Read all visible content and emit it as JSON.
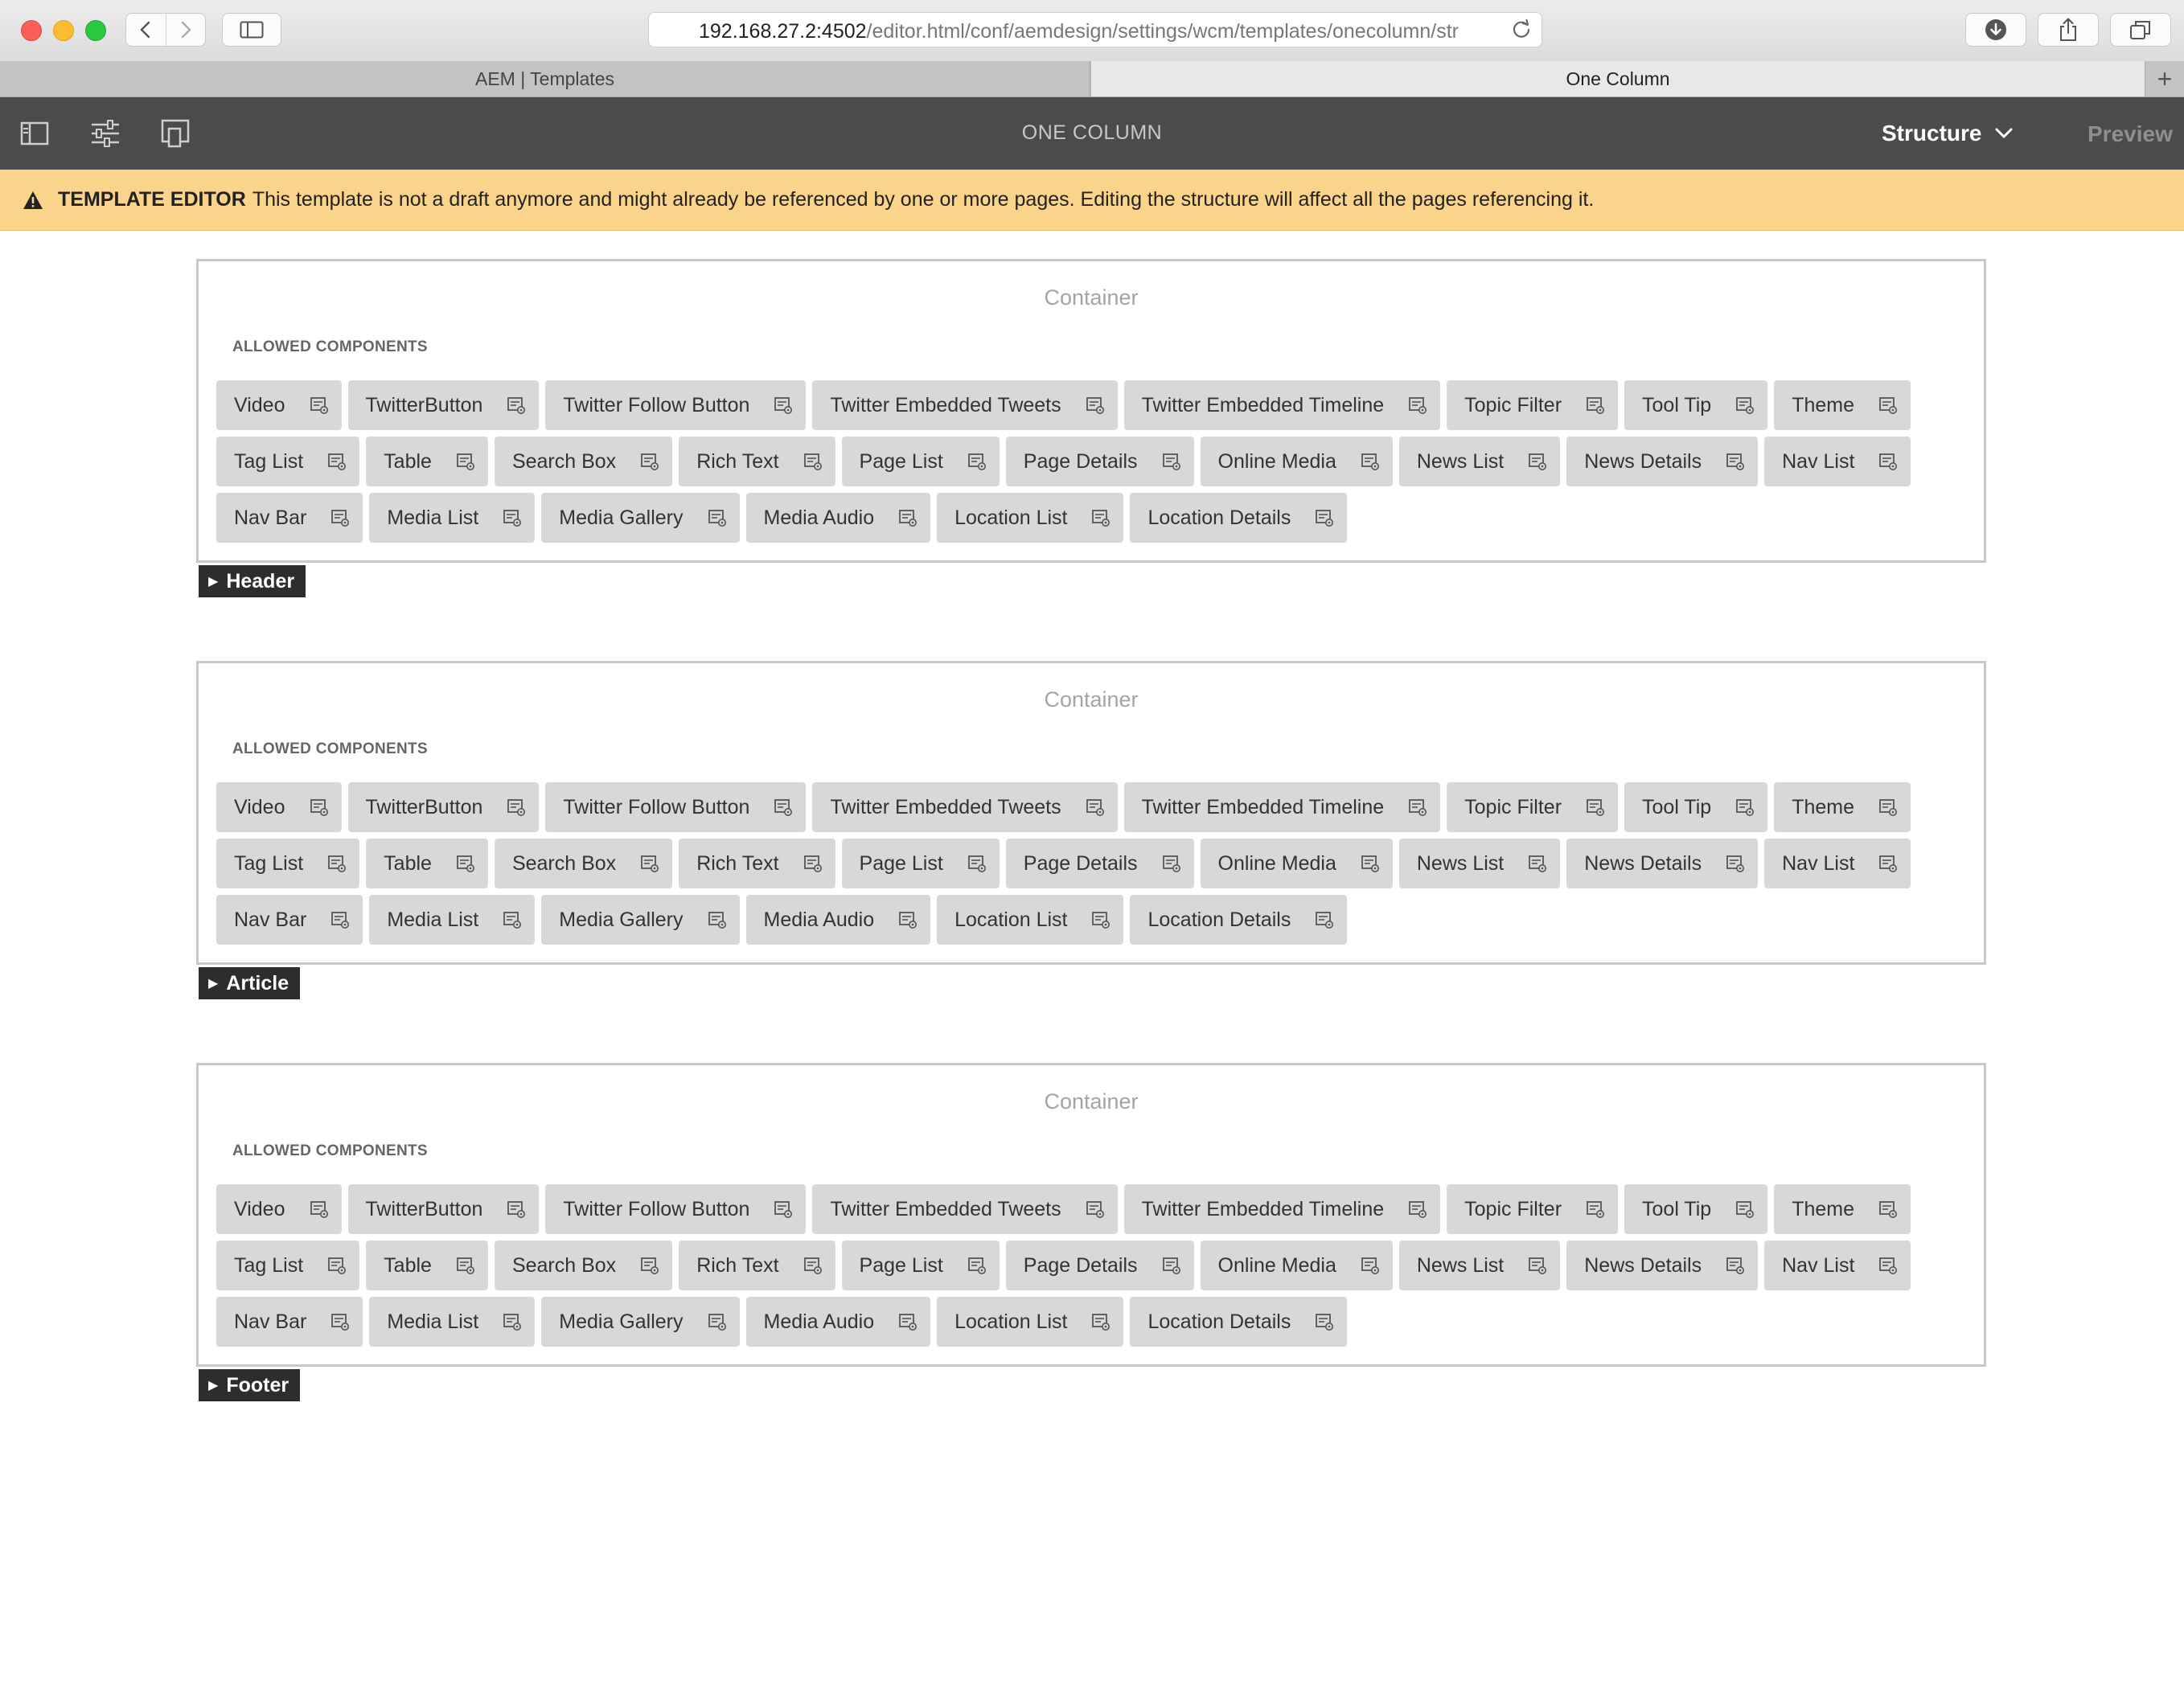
{
  "browser": {
    "url_host": "192.168.27.2:4502",
    "url_path": "/editor.html/conf/aemdesign/settings/wcm/templates/onecolumn/str",
    "tabs": [
      {
        "label": "AEM | Templates",
        "active": false
      },
      {
        "label": "One Column",
        "active": true
      }
    ],
    "new_tab_label": "+"
  },
  "toolbar": {
    "title": "ONE COLUMN",
    "mode": "Structure",
    "preview_label": "Preview"
  },
  "alert": {
    "title": "TEMPLATE EDITOR",
    "message": "This template is not a draft anymore and might already be referenced by one or more pages. Editing the structure will affect all the pages referencing it.",
    "color": "#f9d48a"
  },
  "sections": [
    {
      "label": "Header",
      "container_title": "Container",
      "allowed_heading": "ALLOWED COMPONENTS",
      "components": [
        "Video",
        "TwitterButton",
        "Twitter Follow Button",
        "Twitter Embedded Tweets",
        "Twitter Embedded Timeline",
        "Topic Filter",
        "Tool Tip",
        "Theme",
        "Tag List",
        "Table",
        "Search Box",
        "Rich Text",
        "Page List",
        "Page Details",
        "Online Media",
        "News List",
        "News Details",
        "Nav List",
        "Nav Bar",
        "Media List",
        "Media Gallery",
        "Media Audio",
        "Location List",
        "Location Details"
      ]
    },
    {
      "label": "Article",
      "container_title": "Container",
      "allowed_heading": "ALLOWED COMPONENTS",
      "components": [
        "Video",
        "TwitterButton",
        "Twitter Follow Button",
        "Twitter Embedded Tweets",
        "Twitter Embedded Timeline",
        "Topic Filter",
        "Tool Tip",
        "Theme",
        "Tag List",
        "Table",
        "Search Box",
        "Rich Text",
        "Page List",
        "Page Details",
        "Online Media",
        "News List",
        "News Details",
        "Nav List",
        "Nav Bar",
        "Media List",
        "Media Gallery",
        "Media Audio",
        "Location List",
        "Location Details"
      ]
    },
    {
      "label": "Footer",
      "container_title": "Container",
      "allowed_heading": "ALLOWED COMPONENTS",
      "components": [
        "Video",
        "TwitterButton",
        "Twitter Follow Button",
        "Twitter Embedded Tweets",
        "Twitter Embedded Timeline",
        "Topic Filter",
        "Tool Tip",
        "Theme",
        "Tag List",
        "Table",
        "Search Box",
        "Rich Text",
        "Page List",
        "Page Details",
        "Online Media",
        "News List",
        "News Details",
        "Nav List",
        "Nav Bar",
        "Media List",
        "Media Gallery",
        "Media Audio",
        "Location List",
        "Location Details"
      ]
    }
  ],
  "icons": {
    "chip_policy": "policy-icon",
    "toolbar": [
      "side-panel-icon",
      "properties-icon",
      "emulator-icon"
    ]
  }
}
